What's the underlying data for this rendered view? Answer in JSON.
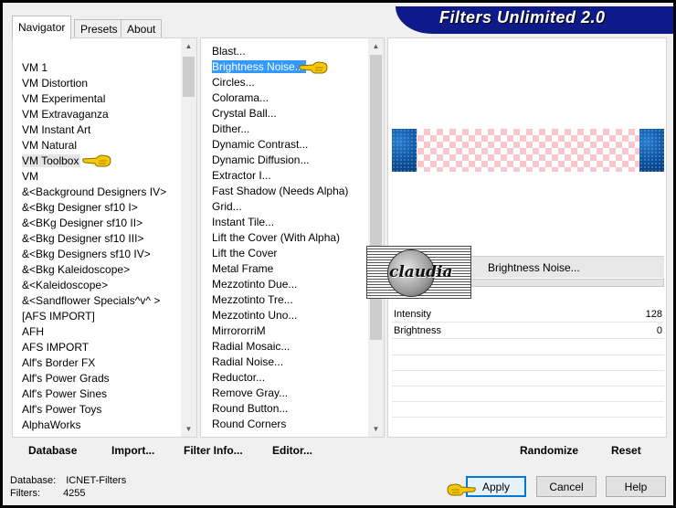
{
  "app": {
    "title": "Filters Unlimited 2.0"
  },
  "tabs": [
    {
      "label": "Navigator",
      "active": true
    },
    {
      "label": "Presets",
      "active": false
    },
    {
      "label": "About",
      "active": false
    }
  ],
  "categories": [
    {
      "label": "VM 1"
    },
    {
      "label": "VM Distortion"
    },
    {
      "label": "VM Experimental"
    },
    {
      "label": "VM Extravaganza"
    },
    {
      "label": "VM Instant Art"
    },
    {
      "label": "VM Natural"
    },
    {
      "label": "VM Toolbox",
      "state": "hover"
    },
    {
      "label": "VM"
    },
    {
      "label": "&<Background Designers IV>"
    },
    {
      "label": "&<Bkg Designer sf10 I>"
    },
    {
      "label": "&<BKg Designer sf10 II>"
    },
    {
      "label": "&<Bkg Designer sf10 III>"
    },
    {
      "label": "&<Bkg Designers sf10 IV>"
    },
    {
      "label": "&<Bkg Kaleidoscope>"
    },
    {
      "label": "&<Kaleidoscope>"
    },
    {
      "label": "&<Sandflower Specials^v^ >"
    },
    {
      "label": "[AFS IMPORT]"
    },
    {
      "label": "AFH"
    },
    {
      "label": "AFS IMPORT"
    },
    {
      "label": "Alf's Border FX"
    },
    {
      "label": "Alf's Power Grads"
    },
    {
      "label": "Alf's Power Sines"
    },
    {
      "label": "Alf's Power Toys"
    },
    {
      "label": "AlphaWorks"
    }
  ],
  "filters": [
    {
      "label": "Blast..."
    },
    {
      "label": "Brightness Noise...",
      "state": "selected"
    },
    {
      "label": "Circles..."
    },
    {
      "label": "Colorama..."
    },
    {
      "label": "Crystal Ball..."
    },
    {
      "label": "Dither..."
    },
    {
      "label": "Dynamic Contrast..."
    },
    {
      "label": "Dynamic Diffusion..."
    },
    {
      "label": "Extractor I..."
    },
    {
      "label": "Fast Shadow (Needs Alpha)"
    },
    {
      "label": "Grid..."
    },
    {
      "label": "Instant Tile..."
    },
    {
      "label": "Lift the Cover (With Alpha)"
    },
    {
      "label": "Lift the Cover"
    },
    {
      "label": "Metal Frame"
    },
    {
      "label": "Mezzotinto Due..."
    },
    {
      "label": "Mezzotinto Tre..."
    },
    {
      "label": "Mezzotinto Uno..."
    },
    {
      "label": "MirrororriM"
    },
    {
      "label": "Radial Mosaic..."
    },
    {
      "label": "Radial Noise..."
    },
    {
      "label": "Reductor..."
    },
    {
      "label": "Remove Gray..."
    },
    {
      "label": "Round Button..."
    },
    {
      "label": "Round Corners"
    }
  ],
  "preview": {
    "filter_name": "Brightness Noise...",
    "params": [
      {
        "name": "Intensity",
        "value": "128"
      },
      {
        "name": "Brightness",
        "value": "0"
      }
    ]
  },
  "watermark": {
    "text": "claudia"
  },
  "toolbar": {
    "database_label": "Database",
    "import_label": "Import...",
    "filter_info_label": "Filter Info...",
    "editor_label": "Editor...",
    "randomize_label": "Randomize",
    "reset_label": "Reset"
  },
  "status": {
    "database_label": "Database:",
    "database_value": "ICNET-Filters",
    "filters_label": "Filters:",
    "filters_value": "4255"
  },
  "buttons": {
    "apply_label": "Apply",
    "cancel_label": "Cancel",
    "help_label": "Help"
  },
  "colors": {
    "title_banner": "#0f1a8a",
    "selection": "#3399ff",
    "preview_edge": "#0e4f97",
    "checker_pink": "#f8c6cc",
    "pointer_hand": "#f5c800"
  }
}
